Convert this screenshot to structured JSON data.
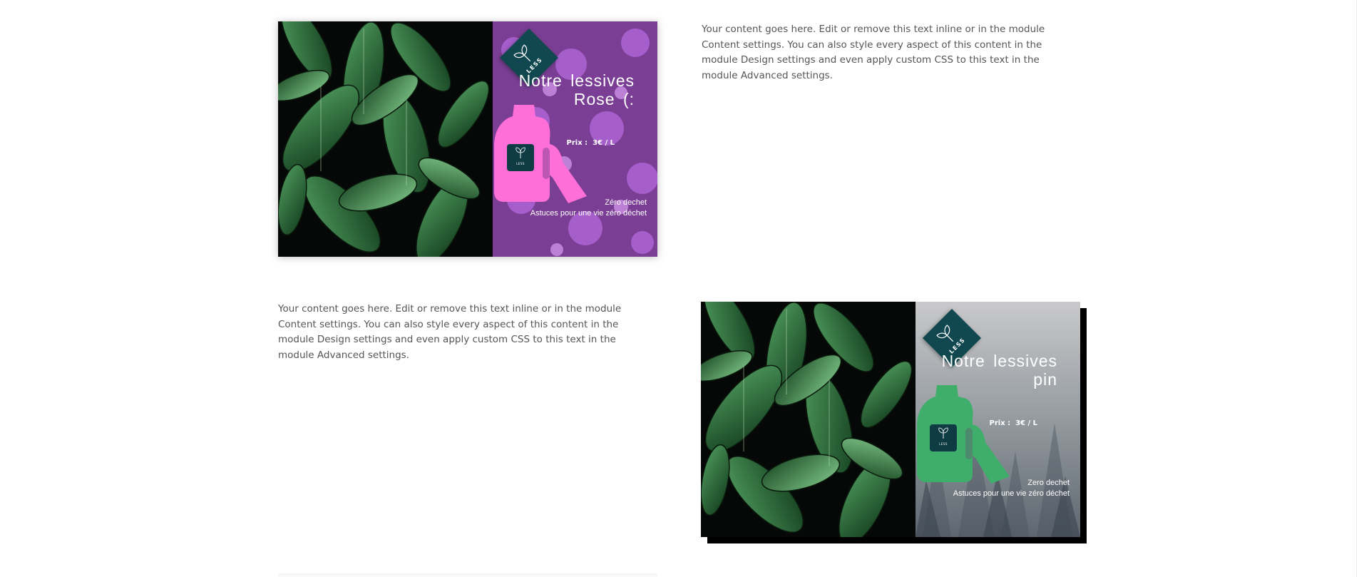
{
  "content": {
    "paragraph_top": "Your content goes here. Edit or remove this text inline or in the module Content settings. You can also style every aspect of this content in the module Design settings and even apply custom CSS to this text in the module Advanced settings.",
    "paragraph_bottom": "Your content goes here. Edit or remove this text inline or in the module Content settings. You can also style every aspect of this content in the module Design settings and even apply custom CSS to this text in the module Advanced settings."
  },
  "cards": [
    {
      "badge_text": "LESS",
      "title_line1": "Notre lessives",
      "title_line2": "Rose (:",
      "price": "Prix :  3€ / L",
      "bottle_label": "LESS",
      "tag_line1": "Zéro dechet",
      "tag_line2": "Astuces pour une vie zéro déchet",
      "bottle_color": "#ff6fd8",
      "background_theme": "purple flowers"
    },
    {
      "badge_text": "LESS",
      "title_line1": "Notre lessives",
      "title_line2": "pin",
      "price": "Prix :  3€ / L",
      "bottle_label": "LESS",
      "tag_line1": "Zero dechet",
      "tag_line2": "Astuces pour une vie zéro déchet",
      "bottle_color": "#3fae6a",
      "background_theme": "misty forest"
    }
  ],
  "colors": {
    "badge": "#11484f",
    "text_body": "#555555"
  }
}
